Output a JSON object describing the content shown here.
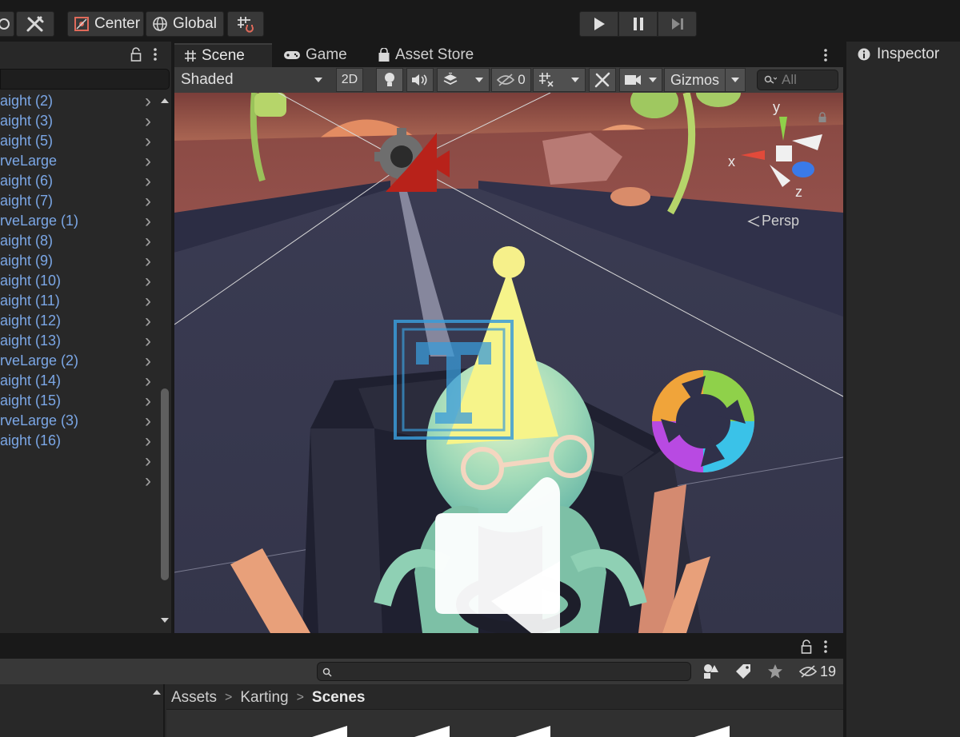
{
  "toolbar": {
    "pivot_label": "Center",
    "space_label": "Global"
  },
  "hierarchy": {
    "items": [
      {
        "label": "aight (2)"
      },
      {
        "label": "aight (3)"
      },
      {
        "label": "aight (5)"
      },
      {
        "label": "rveLarge"
      },
      {
        "label": "aight (6)"
      },
      {
        "label": "aight (7)"
      },
      {
        "label": "rveLarge (1)"
      },
      {
        "label": "aight (8)"
      },
      {
        "label": "aight (9)"
      },
      {
        "label": "aight (10)"
      },
      {
        "label": "aight (11)"
      },
      {
        "label": "aight (12)"
      },
      {
        "label": "aight (13)"
      },
      {
        "label": "rveLarge (2)"
      },
      {
        "label": "aight (14)"
      },
      {
        "label": "aight (15)"
      },
      {
        "label": "rveLarge (3)"
      },
      {
        "label": "aight (16)"
      },
      {
        "label": ""
      },
      {
        "label": ""
      }
    ]
  },
  "tabs": [
    {
      "label": "Scene",
      "icon": "grid-icon"
    },
    {
      "label": "Game",
      "icon": "gamepad-icon"
    },
    {
      "label": "Asset Store",
      "icon": "bag-icon"
    }
  ],
  "scene_toolbar": {
    "draw_mode": "Shaded",
    "mode_2d": "2D",
    "hidden_count": "0",
    "gizmos_label": "Gizmos",
    "search_placeholder": "All"
  },
  "gizmo": {
    "axis_y": "y",
    "axis_x": "x",
    "axis_z": "z",
    "projection": "Persp"
  },
  "inspector": {
    "title": "Inspector"
  },
  "project": {
    "hidden_count": "19",
    "breadcrumb": [
      "Assets",
      "Karting",
      "Scenes"
    ]
  },
  "colors": {
    "accent_link": "#7ba7e6",
    "panel_bg": "#282828",
    "toolbar_bg": "#191919"
  }
}
